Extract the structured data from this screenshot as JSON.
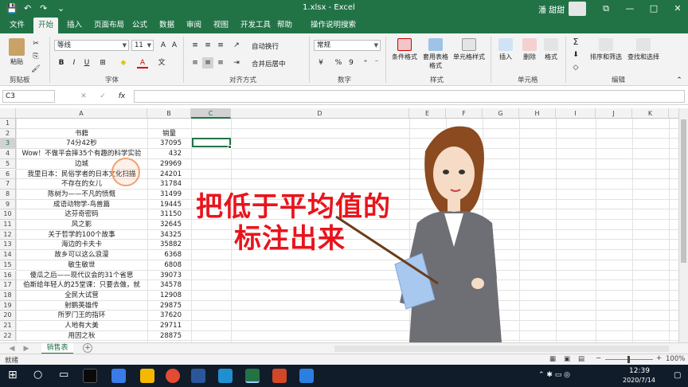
{
  "titlebar": {
    "filename": "1.xlsx - Excel",
    "user": "潘 甜甜",
    "qa_save": "💾",
    "qa_undo": "↶",
    "qa_redo": "↷",
    "qa_custom": "⌄",
    "win_restore": "⧉",
    "win_min": "—",
    "win_max": "□",
    "win_close": "✕"
  },
  "tabs": [
    "文件",
    "开始",
    "插入",
    "页面布局",
    "公式",
    "数据",
    "审阅",
    "视图",
    "开发工具",
    "帮助",
    "操作说明搜索"
  ],
  "ribbon": {
    "paste": "粘贴",
    "clipboard": "剪贴板",
    "font_name": "等线",
    "font_size": "11",
    "font_group": "字体",
    "wrap": "自动换行",
    "merge": "合并后居中",
    "align_group": "对齐方式",
    "numfmt": "常规",
    "number_group": "数字",
    "cond_fmt": "条件格式",
    "table_fmt": "套用表格格式",
    "cell_style": "单元格样式",
    "style_group": "样式",
    "insert": "插入",
    "delete": "删除",
    "format": "格式",
    "cells_group": "单元格",
    "sort": "排序和筛选",
    "find": "查找和选择",
    "edit_group": "编辑",
    "bold": "B",
    "italic": "I",
    "underline": "U",
    "font_color": "A",
    "percent": "%",
    "comma": "9",
    "sum": "Σ"
  },
  "formula_bar": {
    "name_box": "C3",
    "fx": "fx",
    "cancel": "✕",
    "enter": "✓",
    "content": ""
  },
  "columns": [
    "A",
    "B",
    "C",
    "D",
    "E",
    "F",
    "G",
    "H",
    "I",
    "J",
    "K"
  ],
  "rows": [
    "1",
    "2",
    "3",
    "4",
    "5",
    "6",
    "7",
    "8",
    "9",
    "10",
    "11",
    "12",
    "13",
    "14",
    "15",
    "16",
    "17",
    "18",
    "19",
    "20",
    "21",
    "22"
  ],
  "cells": [
    {
      "a": "",
      "b": ""
    },
    {
      "a": "书籍",
      "b": "销量"
    },
    {
      "a": "74分42秒",
      "b": "37095"
    },
    {
      "a": "Wow！不做平会摔35个有趣的科学实验",
      "b": "432"
    },
    {
      "a": "边城",
      "b": "29969"
    },
    {
      "a": "我里日本：民俗学者的日本文化扫描",
      "b": "24201"
    },
    {
      "a": "不存在的女儿",
      "b": "31784"
    },
    {
      "a": "陈树为——不凡的愤慨",
      "b": "31499"
    },
    {
      "a": "成语动物学-鸟兽篇",
      "b": "19445"
    },
    {
      "a": "达芬奇密码",
      "b": "31150"
    },
    {
      "a": "风之影",
      "b": "32645"
    },
    {
      "a": "关于哲学的100个故事",
      "b": "34325"
    },
    {
      "a": "海边的卡夫卡",
      "b": "35882"
    },
    {
      "a": "故乡可以这么浪漫",
      "b": "6368"
    },
    {
      "a": "敏生敏世",
      "b": "6808"
    },
    {
      "a": "傻瓜之后——现代议会的31个省思",
      "b": "39073"
    },
    {
      "a": "伯斯给年轻人的25堂课：只要去做，就",
      "b": "34578"
    },
    {
      "a": "全民大试营",
      "b": "12908"
    },
    {
      "a": "射鹏英雄传",
      "b": "29875"
    },
    {
      "a": "所罗门王的指环",
      "b": "37620"
    },
    {
      "a": "人地有大美",
      "b": "29711"
    },
    {
      "a": "用因之秋",
      "b": "28875"
    }
  ],
  "overlay": {
    "line1": "把低于平均值的",
    "line2": "标注出来"
  },
  "sheet": {
    "name": "销售表",
    "add": "+"
  },
  "status": {
    "left": "就绪",
    "zoom": "100%"
  },
  "taskbar": {
    "time": "12:39",
    "date": "2020/7/14"
  },
  "colors": {
    "excel_green": "#217346",
    "overlay_red": "#e8141c",
    "taskbar": "#101c2a"
  }
}
